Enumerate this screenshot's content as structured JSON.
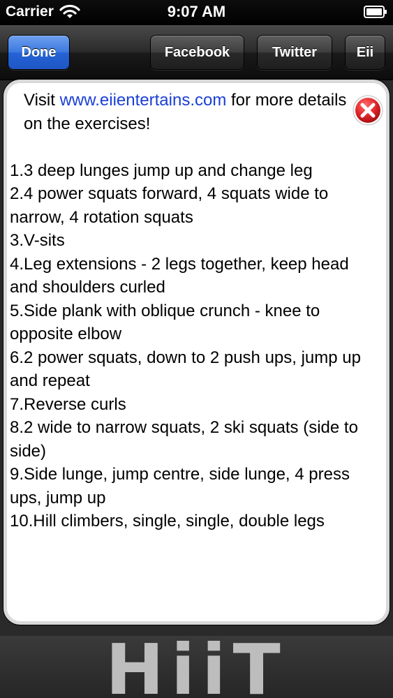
{
  "status_bar": {
    "carrier": "Carrier",
    "time": "9:07 AM",
    "wifi_icon": "wifi-icon",
    "battery_icon": "battery-icon"
  },
  "toolbar": {
    "done_label": "Done",
    "facebook_label": "Facebook",
    "twitter_label": "Twitter",
    "eii_label": "Eii"
  },
  "panel": {
    "intro_before": "Visit ",
    "link_text": "www.eiientertains.com",
    "intro_after": " for more details on the exercises!",
    "close_icon": "close-icon",
    "exercises": [
      " 1.3 deep lunges jump up and change leg",
      " 2.4 power squats forward, 4 squats wide to narrow, 4 rotation squats",
      " 3.V-sits",
      " 4.Leg extensions - 2 legs together, keep head and shoulders curled",
      " 5.Side plank with oblique crunch - knee to opposite elbow",
      " 6.2 power squats, down to 2 push ups, jump up and repeat",
      " 7.Reverse curls",
      " 8.2 wide to narrow squats, 2 ski squats  (side to side)",
      " 9.Side lunge, jump centre, side lunge, 4 press ups, jump up",
      " 10.Hill climbers, single, single, double legs"
    ]
  },
  "footer": {
    "logo_text": "HiiT"
  },
  "colors": {
    "done_button": "#2f6fdc",
    "link": "#1a3fd6",
    "close_red": "#e0262b"
  }
}
